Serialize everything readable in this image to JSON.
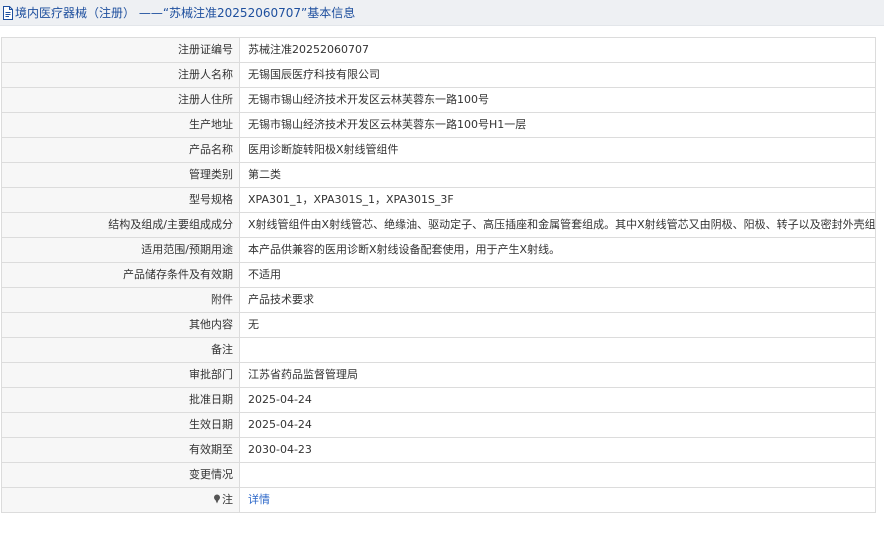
{
  "header": {
    "icon": "document-icon",
    "title": "境内医疗器械（注册） ——“苏械注准20252060707”基本信息"
  },
  "rows": [
    {
      "key": "registration-number",
      "label": "注册证编号",
      "value": "苏械注准20252060707"
    },
    {
      "key": "registrant-name",
      "label": "注册人名称",
      "value": "无锡国辰医疗科技有限公司"
    },
    {
      "key": "registrant-address",
      "label": "注册人住所",
      "value": "无锡市锡山经济技术开发区云林芙蓉东一路100号"
    },
    {
      "key": "production-address",
      "label": "生产地址",
      "value": "无锡市锡山经济技术开发区云林芙蓉东一路100号H1一层"
    },
    {
      "key": "product-name",
      "label": "产品名称",
      "value": "医用诊断旋转阳极X射线管组件"
    },
    {
      "key": "management-category",
      "label": "管理类别",
      "value": "第二类"
    },
    {
      "key": "model-spec",
      "label": "型号规格",
      "value": "XPA301_1，XPA301S_1，XPA301S_3F"
    },
    {
      "key": "structure-composition",
      "label": "结构及组成/主要组成成分",
      "value": "X射线管组件由X射线管芯、绝缘油、驱动定子、高压插座和金属管套组成。其中X射线管芯又由阴极、阳极、转子以及密封外壳组成。"
    },
    {
      "key": "scope-of-use",
      "label": "适用范围/预期用途",
      "value": "本产品供兼容的医用诊断X射线设备配套使用，用于产生X射线。"
    },
    {
      "key": "storage-validity",
      "label": "产品储存条件及有效期",
      "value": "不适用"
    },
    {
      "key": "attachment",
      "label": "附件",
      "value": "产品技术要求"
    },
    {
      "key": "other-content",
      "label": "其他内容",
      "value": "无"
    },
    {
      "key": "remarks",
      "label": "备注",
      "value": ""
    },
    {
      "key": "approval-department",
      "label": "审批部门",
      "value": "江苏省药品监督管理局"
    },
    {
      "key": "approval-date",
      "label": "批准日期",
      "value": "2025-04-24"
    },
    {
      "key": "effective-date",
      "label": "生效日期",
      "value": "2025-04-24"
    },
    {
      "key": "expiry-date",
      "label": "有效期至",
      "value": "2030-04-23"
    },
    {
      "key": "change-status",
      "label": "变更情况",
      "value": ""
    }
  ],
  "note_row": {
    "icon": "pin-icon",
    "label": "注",
    "link_text": "详情"
  },
  "colors": {
    "title_text": "#1e4f9e",
    "link": "#2a66c8",
    "label_bg": "#f7f7f7",
    "border": "#dcdcdc"
  }
}
